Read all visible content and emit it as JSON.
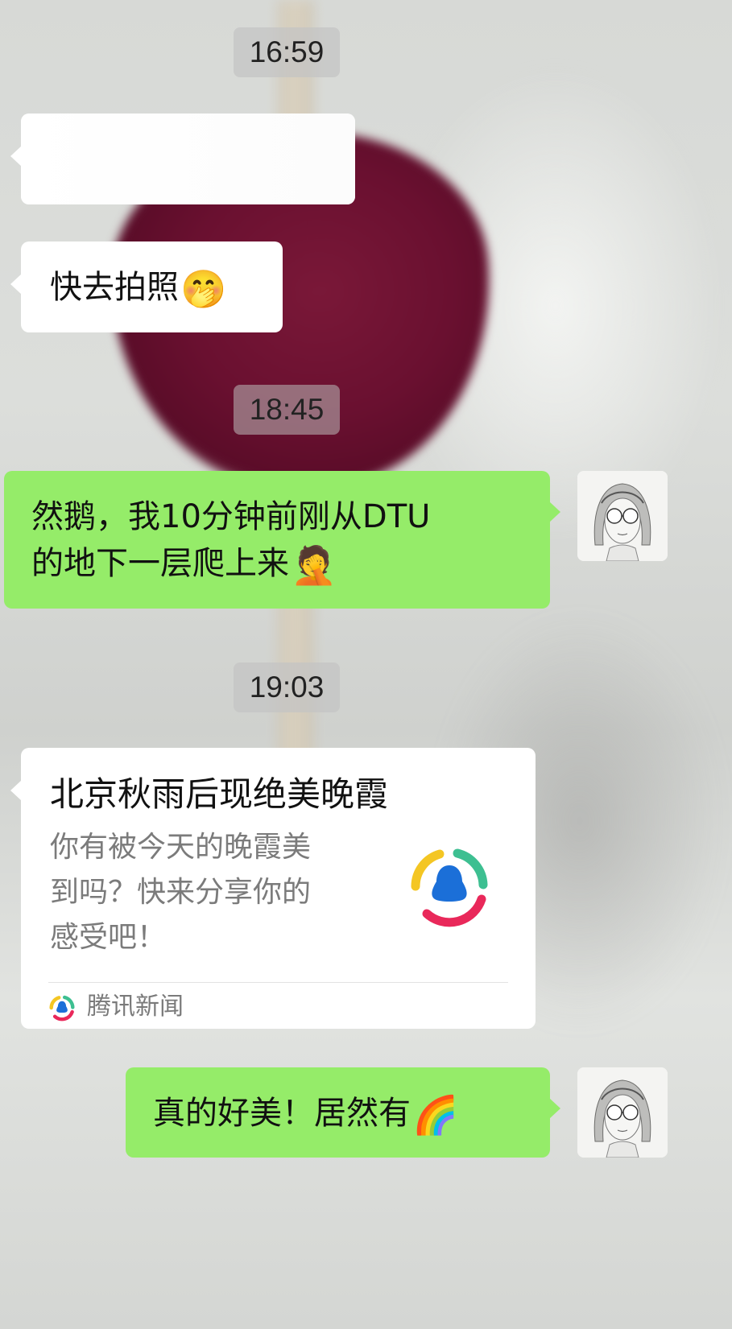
{
  "conversation": {
    "timestamps": [
      "16:59",
      "18:45",
      "19:03"
    ],
    "messages": [
      {
        "side": "left",
        "type": "text",
        "text": "快去拍照",
        "emoji": "🤭",
        "emoji_name": "face-with-hand-over-mouth"
      },
      {
        "side": "right",
        "type": "text",
        "line1": "然鹅，我10分钟前刚从DTU",
        "line2": "的地下一层爬上来",
        "emoji": "🤦",
        "emoji_name": "facepalm"
      },
      {
        "side": "left",
        "type": "link_card",
        "title": "北京秋雨后现绝美晚霞",
        "desc_lines": [
          "你有被今天的晚霞美",
          "到吗？快来分享你的",
          "感受吧！"
        ],
        "source": "腾讯新闻",
        "source_icon": "tencent-news-logo"
      },
      {
        "side": "right",
        "type": "text",
        "text": "真的好美！居然有",
        "emoji": "🌈",
        "emoji_name": "rainbow"
      }
    ]
  },
  "colors": {
    "sent_bubble": "#95ec69",
    "received_bubble": "#ffffff",
    "timestamp_chip": "#c3c3c3"
  },
  "icons": {
    "avatar": "sketch-girl-avatar",
    "logo": "tencent-news-logo"
  }
}
